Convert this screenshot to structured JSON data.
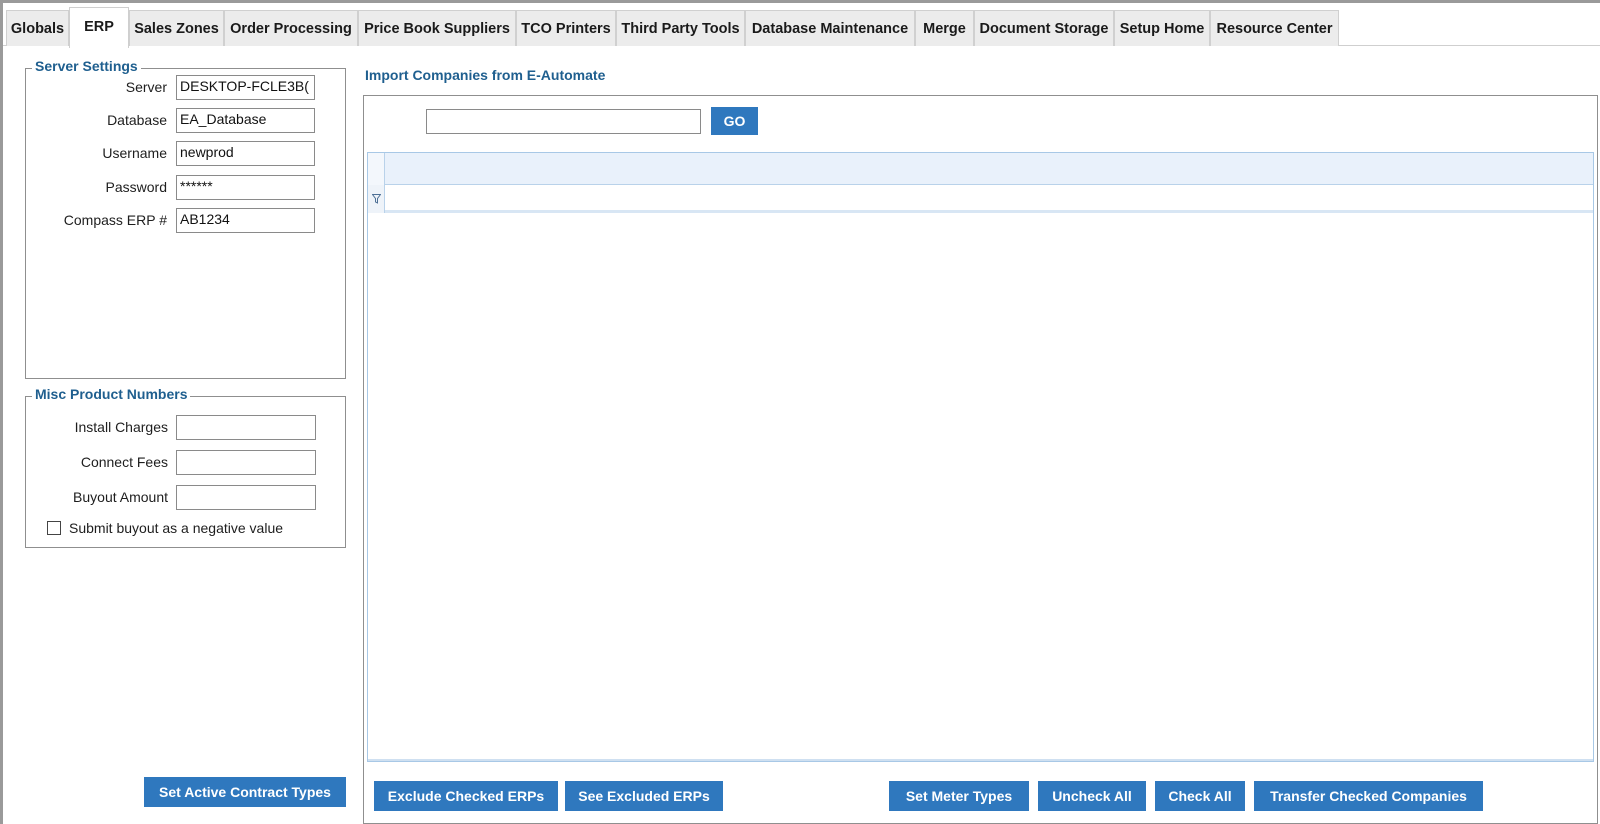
{
  "tabs": [
    {
      "label": "Globals",
      "active": false
    },
    {
      "label": "ERP",
      "active": true
    },
    {
      "label": "Sales Zones",
      "active": false
    },
    {
      "label": "Order Processing",
      "active": false
    },
    {
      "label": "Price Book Suppliers",
      "active": false
    },
    {
      "label": "TCO Printers",
      "active": false
    },
    {
      "label": "Third Party Tools",
      "active": false
    },
    {
      "label": "Database Maintenance",
      "active": false
    },
    {
      "label": "Merge",
      "active": false
    },
    {
      "label": "Document Storage",
      "active": false
    },
    {
      "label": "Setup Home",
      "active": false
    },
    {
      "label": "Resource Center",
      "active": false
    }
  ],
  "server_settings": {
    "title": "Server Settings",
    "fields": [
      {
        "label": "Server",
        "value": "DESKTOP-FCLE3B("
      },
      {
        "label": "Database",
        "value": "EA_Database"
      },
      {
        "label": "Username",
        "value": "newprod"
      },
      {
        "label": "Password",
        "value": "******"
      },
      {
        "label": "Compass ERP #",
        "value": "AB1234"
      }
    ]
  },
  "misc_products": {
    "title": "Misc Product Numbers",
    "fields": [
      {
        "label": "Install Charges",
        "value": ""
      },
      {
        "label": "Connect Fees",
        "value": ""
      },
      {
        "label": "Buyout Amount",
        "value": ""
      }
    ],
    "checkbox_label": "Submit buyout as a negative value",
    "checkbox_checked": false
  },
  "set_active_contract_types_label": "Set Active Contract Types",
  "import": {
    "title": "Import Companies from E-Automate",
    "search_value": "",
    "go_label": "GO"
  },
  "bottom_buttons": {
    "exclude": "Exclude Checked ERPs",
    "see_excluded": "See Excluded ERPs",
    "set_meter": "Set Meter Types",
    "uncheck_all": "Uncheck All",
    "check_all": "Check All",
    "transfer": "Transfer Checked Companies"
  },
  "colors": {
    "accent": "#2f78be",
    "heading": "#1f5f8f"
  },
  "icons": {
    "grid_filter": "filter-icon"
  }
}
